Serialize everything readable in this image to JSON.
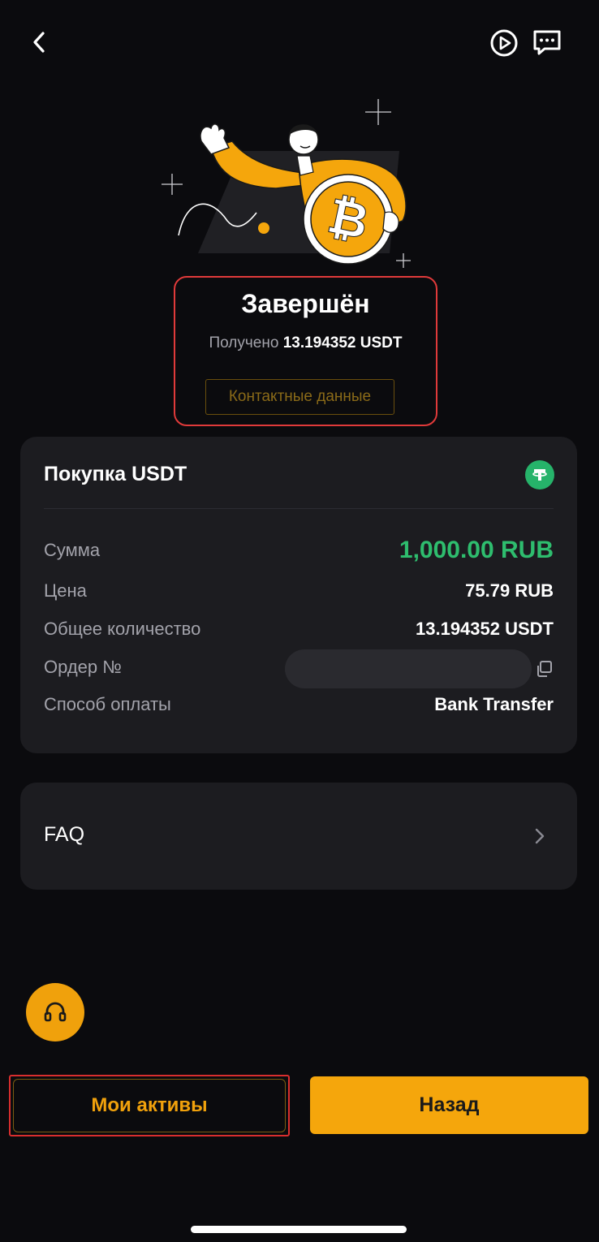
{
  "status": {
    "title": "Завершён",
    "received_label": "Получено",
    "received_value": "13.194352 USDT",
    "contact_button": "Контактные данные"
  },
  "order": {
    "title": "Покупка USDT",
    "token_icon": "tether-icon",
    "rows": [
      {
        "label": "Сумма",
        "value": "1,000.00 RUB"
      },
      {
        "label": "Цена",
        "value": "75.79 RUB"
      },
      {
        "label": "Общее количество",
        "value": "13.194352 USDT"
      },
      {
        "label": "Ордер №",
        "value": ""
      },
      {
        "label": "Способ оплаты",
        "value": "Bank Transfer"
      }
    ]
  },
  "faq": {
    "label": "FAQ"
  },
  "buttons": {
    "my_assets": "Мои активы",
    "back": "Назад"
  },
  "icons": {
    "back": "chevron-left-icon",
    "play": "play-circle-icon",
    "chat": "chat-bubble-icon",
    "support": "headset-icon",
    "copy": "copy-icon",
    "faq_chevron": "chevron-right-icon"
  },
  "colors": {
    "background": "#0b0b0e",
    "card": "#1c1c20",
    "accent": "#f0a10c",
    "positive": "#2ebd6e",
    "highlight_outline": "#e03a3a"
  }
}
